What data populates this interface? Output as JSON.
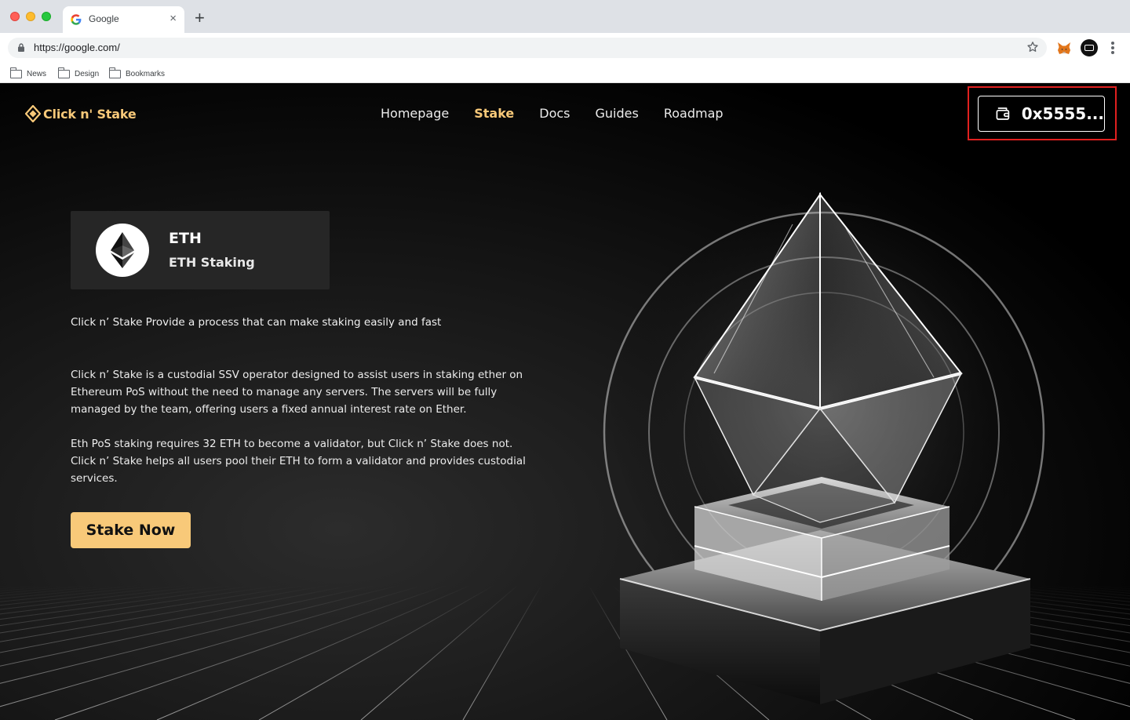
{
  "browser": {
    "tab_title": "Google",
    "tab_close": "×",
    "new_tab": "+",
    "url": "https://google.com/",
    "bookmarks": [
      "News",
      "Design",
      "Bookmarks"
    ]
  },
  "site": {
    "logo_text": "Click n' Stake",
    "nav": [
      "Homepage",
      "Stake",
      "Docs",
      "Guides",
      "Roadmap"
    ],
    "active_nav": "Stake",
    "wallet_address": "0x5555...",
    "accent_color": "#f8c979",
    "highlight_color": "#e0201f"
  },
  "token": {
    "symbol": "ETH",
    "name": "ETH Staking",
    "icon": "ethereum-icon"
  },
  "content": {
    "tagline": "Click n’ Stake Provide a process that can make staking easily and fast",
    "paragraph_1": "Click n’ Stake is a custodial SSV operator designed to assist users in staking ether on Ethereum PoS without the need to manage any servers. The servers will be fully managed by the team, offering users a fixed annual interest rate on Ether.",
    "paragraph_2": "Eth PoS staking requires 32 ETH to become a validator, but Click n’ Stake does not. Click n’ Stake helps all users pool their ETH to form a validator and provides custodial services.",
    "cta": "Stake Now"
  }
}
